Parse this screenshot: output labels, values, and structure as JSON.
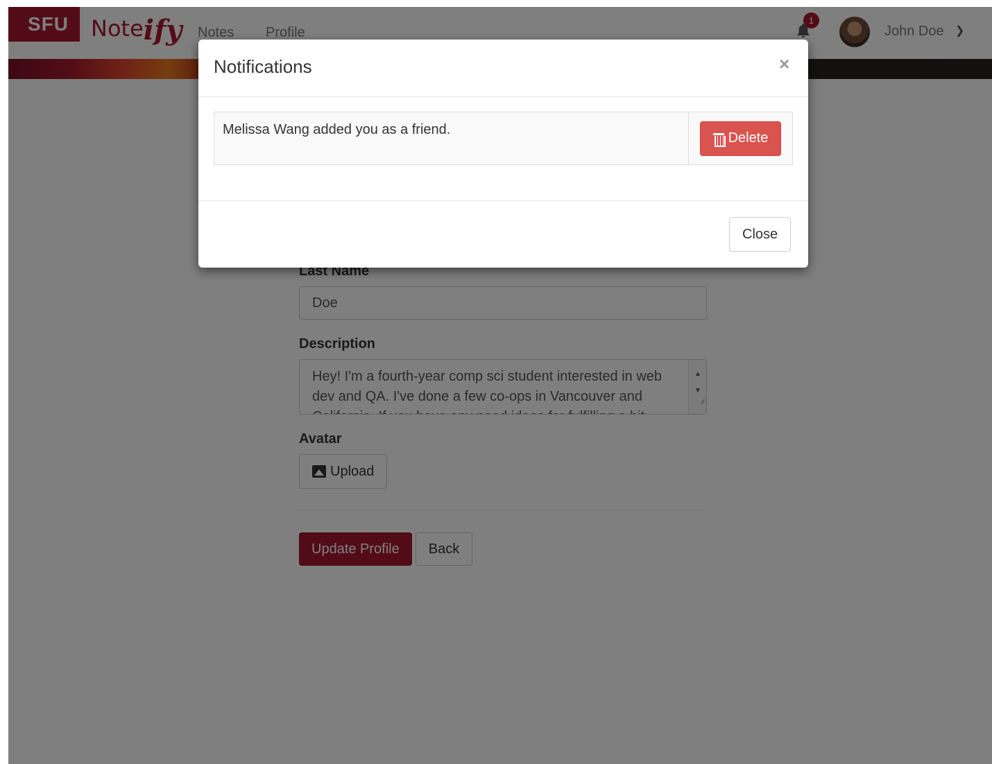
{
  "navbar": {
    "brand_sfu": "SFU",
    "brand_notes": "Note",
    "brand_script": "ify",
    "links": [
      {
        "label": "Notes"
      },
      {
        "label": "Profile"
      }
    ],
    "notification_count": "1",
    "user_name": "John Doe"
  },
  "form": {
    "last_name_label": "Last Name",
    "last_name_value": "Doe",
    "description_label": "Description",
    "description_value": "Hey! I'm a fourth-year comp sci student interested in web dev and QA. I've done a few co-ops in Vancouver and California. If you have any need ideas for fulfilling a bit",
    "avatar_label": "Avatar",
    "upload_label": "Upload",
    "update_label": "Update Profile",
    "back_label": "Back"
  },
  "modal": {
    "title": "Notifications",
    "close_x": "×",
    "notifications": [
      {
        "message": "Melissa Wang added you as a friend.",
        "delete_label": "Delete"
      }
    ],
    "close_label": "Close"
  },
  "colors": {
    "brand": "#a6192e",
    "danger": "#d9534f"
  }
}
